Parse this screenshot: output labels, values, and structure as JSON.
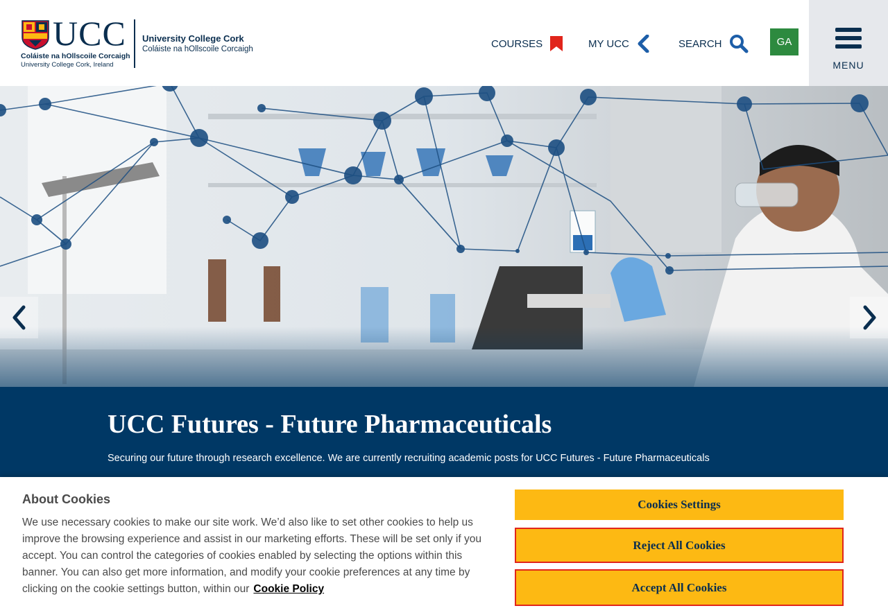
{
  "header": {
    "logo_word": "UCC",
    "logo_line1": "Coláiste na hOllscoile Corcaigh",
    "logo_line2": "University College Cork, Ireland",
    "uni_name": "University College Cork",
    "uni_irish": "Coláiste na hOllscoile Corcaigh",
    "nav": {
      "courses": "COURSES",
      "myucc": "MY UCC",
      "search": "SEARCH"
    },
    "lang_button": "GA",
    "menu_label": "MENU"
  },
  "hero": {
    "slider_icons": [
      "chevron-left-icon",
      "chevron-right-icon"
    ]
  },
  "banner": {
    "title": "UCC Futures - Future Pharmaceuticals",
    "subtitle": "Securing our future through research excellence. We are currently recruiting academic posts for UCC Futures - Future Pharmaceuticals"
  },
  "cookie": {
    "title": "About Cookies",
    "text": "We use necessary cookies to make our site work. We’d also like to set other cookies to help us improve the browsing experience and assist in our marketing efforts. These will be set only if you accept. You can control the categories of cookies enabled by selecting the options within this banner. You can also get more information, and modify your cookie preferences at any time by clicking on the cookie settings button, within our",
    "policy_link": "Cookie Policy",
    "settings_button": "Cookies Settings",
    "reject_button": "Reject All Cookies",
    "accept_button": "Accept All Cookies"
  },
  "colors": {
    "navy": "#003865",
    "ga_green": "#2d8a3f",
    "cookie_yellow": "#fdb913",
    "alert_red": "#e1251b"
  }
}
